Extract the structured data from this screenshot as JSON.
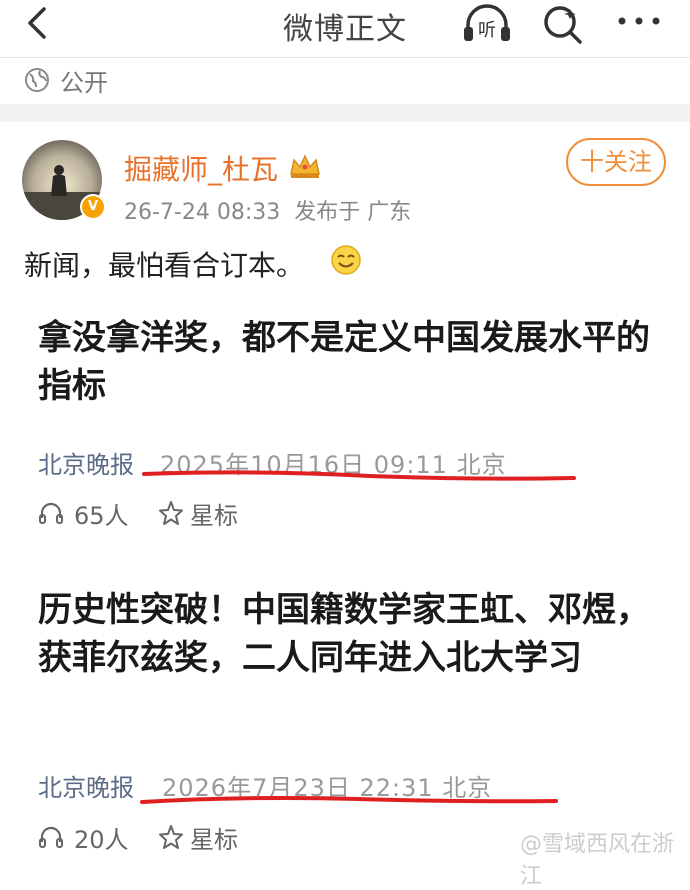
{
  "header": {
    "title": "微博正文",
    "listen_label": "听"
  },
  "visibility": {
    "label": "公开"
  },
  "post": {
    "username": "掘藏师_杜瓦",
    "timestamp": "26-7-24 08:33",
    "location": "发布于 广东",
    "follow_label": "十关注",
    "text": "新闻，最怕看合订本。"
  },
  "articles": [
    {
      "title": "拿没拿洋奖，都不是定义中国发展水平的指标",
      "source": "北京晚报",
      "date": "2025年10月16日  09:11  北京",
      "listeners": "65人",
      "star_label": "星标"
    },
    {
      "title": "历史性突破！中国籍数学家王虹、邓煜，获菲尔兹奖，二人同年进入北大学习",
      "source": "北京晚报",
      "date": "2026年7月23日  22:31  北京",
      "listeners": "20人",
      "star_label": "星标"
    }
  ],
  "watermark": "@雪域西风在浙江",
  "colors": {
    "accent": "#f08f3a",
    "username": "#e8722a",
    "source": "#5c6b87",
    "annotation": "#e02020"
  },
  "icons": [
    "back-icon",
    "listen-icon",
    "search-icon",
    "more-icon",
    "globe-icon",
    "crown-icon",
    "smile-icon",
    "headphone-icon",
    "star-icon"
  ]
}
